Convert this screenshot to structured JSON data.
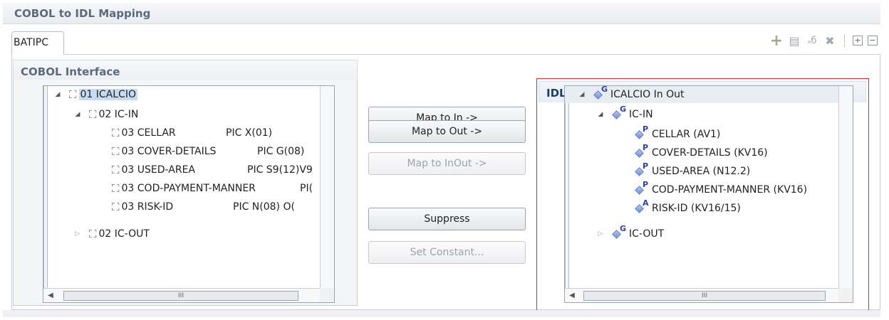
{
  "editor": {
    "title": "COBOL to IDL Mapping"
  },
  "tab": {
    "label": "BATIPC"
  },
  "toolbar": {
    "buttons": [
      {
        "name": "add-icon",
        "glyph": "+"
      },
      {
        "name": "document-icon",
        "glyph": "▤"
      },
      {
        "name": "rename-icon",
        "glyph": "ₐб"
      },
      {
        "name": "delete-icon",
        "glyph": "✖"
      },
      {
        "name": "expand-all-icon",
        "glyph": "+"
      },
      {
        "name": "collapse-all-icon",
        "glyph": "−"
      }
    ]
  },
  "cobol": {
    "header": "COBOL Interface",
    "rows": [
      {
        "label": "01 ICALCIO",
        "pic": "",
        "twisty": "◢",
        "selected": true
      },
      {
        "label": "02 IC-IN",
        "pic": "",
        "twisty": "◢"
      },
      {
        "label": "03 CELLAR",
        "pic": "PIC  X(01)"
      },
      {
        "label": "03 COVER-DETAILS",
        "pic": "PIC  G(08)"
      },
      {
        "label": "03 USED-AREA",
        "pic": "PIC S9(12)V9"
      },
      {
        "label": "03 COD-PAYMENT-MANNER",
        "pic": "PI("
      },
      {
        "label": "03 RISK-ID",
        "pic": "PIC  N(08)     O("
      },
      {
        "label": "02 IC-OUT",
        "pic": "",
        "twisty": "▷"
      }
    ],
    "scroll_thumb": "III"
  },
  "actions": {
    "map_in": "Map to In ->",
    "map_out": "Map to Out ->",
    "map_inout": "Map to InOut ->",
    "suppress": "Suppress",
    "set_constant": "Set Constant..."
  },
  "idl": {
    "header": "IDL Interface",
    "rows": [
      {
        "label": "ICALCIO  In Out",
        "letter": "G",
        "twisty": "◢"
      },
      {
        "label": "IC-IN",
        "letter": "G",
        "twisty": "◢"
      },
      {
        "label": "CELLAR  (AV1)",
        "letter": "P"
      },
      {
        "label": "COVER-DETAILS  (KV16)",
        "letter": "P"
      },
      {
        "label": "USED-AREA  (N12.2)",
        "letter": "P"
      },
      {
        "label": "COD-PAYMENT-MANNER  (KV16)",
        "letter": "P"
      },
      {
        "label": "RISK-ID  (KV16/15)",
        "letter": "A"
      },
      {
        "label": "IC-OUT",
        "letter": "G",
        "twisty": "▷"
      }
    ],
    "scroll_thumb": "III"
  },
  "colors": {
    "highlight_frame": "#e0262c",
    "selection": "#c5dbf2",
    "header_text": "#5a6b80"
  }
}
